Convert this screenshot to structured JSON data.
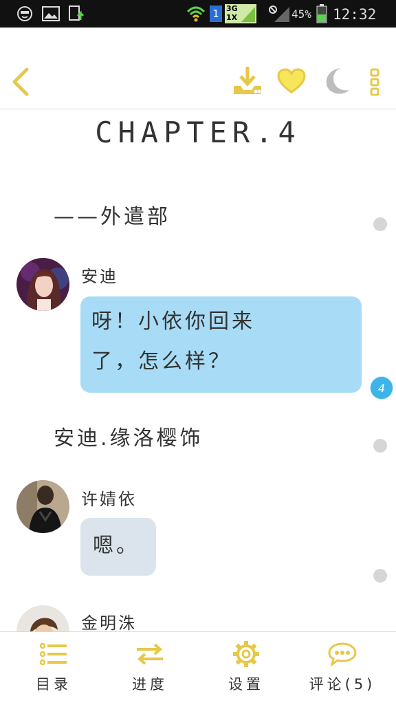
{
  "status_bar": {
    "network_badge_1": "1",
    "network_badge_3g": "3G",
    "network_badge_1x": "1X",
    "battery_percent": "45%",
    "time": "12:32"
  },
  "toolbar": {
    "icons": [
      "back-icon",
      "download-icon",
      "heart-icon",
      "night-mode-icon",
      "more-icon"
    ],
    "accent_color": "#e6c84a"
  },
  "chapter": {
    "title": "CHAPTER.4"
  },
  "story": {
    "narration_1": "——外遣部",
    "msg1": {
      "speaker": "安迪",
      "line1": "呀！小依你回来",
      "line2": "了，怎么样？",
      "comment_count": "4"
    },
    "narration_2": "安迪.缘洛樱饰",
    "msg2": {
      "speaker": "许婧依",
      "text": "嗯。"
    },
    "msg3": {
      "speaker": "金明洙"
    }
  },
  "bottom_nav": {
    "items": [
      {
        "label": "目录",
        "icon": "list-icon"
      },
      {
        "label": "进度",
        "icon": "progress-arrows-icon"
      },
      {
        "label": "设置",
        "icon": "gear-icon"
      },
      {
        "label": "评论(5)",
        "icon": "comment-icon"
      }
    ]
  }
}
